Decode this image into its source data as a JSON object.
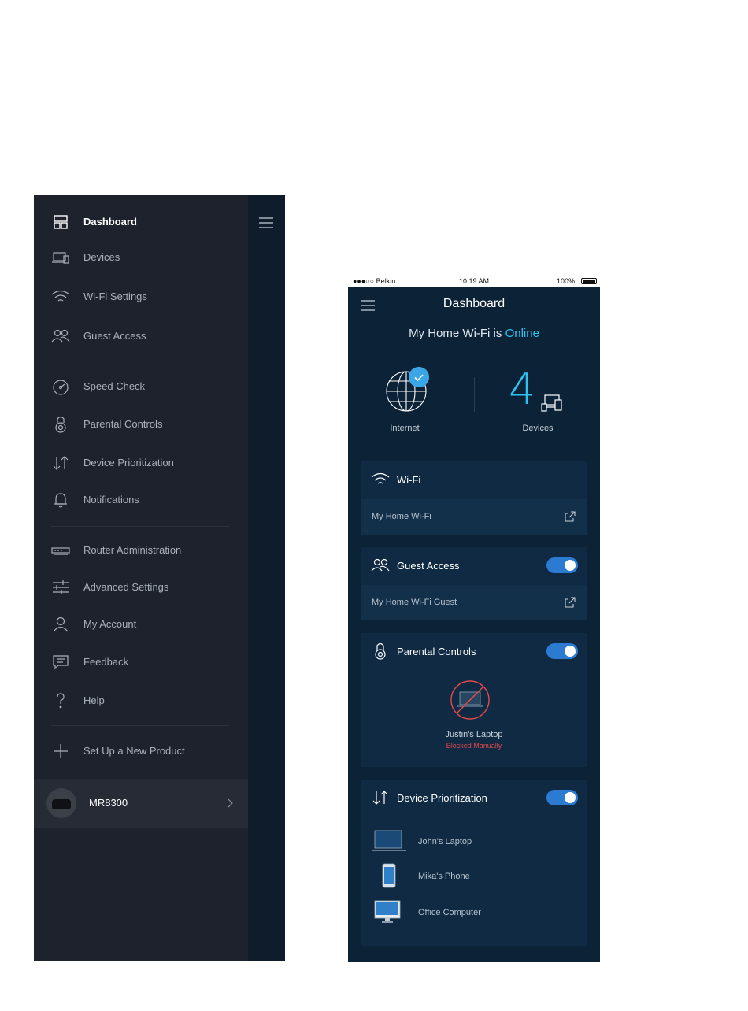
{
  "menu": {
    "items": [
      {
        "label": "Dashboard",
        "icon": "dashboard-icon",
        "active": true
      },
      {
        "label": "Devices",
        "icon": "devices-icon"
      },
      {
        "label": "Wi-Fi Settings",
        "icon": "wifi-icon"
      },
      {
        "label": "Guest Access",
        "icon": "guests-icon"
      },
      {
        "label": "Speed Check",
        "icon": "speedometer-icon"
      },
      {
        "label": "Parental Controls",
        "icon": "lock-icon"
      },
      {
        "label": "Device Prioritization",
        "icon": "up-down-arrows-icon"
      },
      {
        "label": "Notifications",
        "icon": "bell-icon"
      },
      {
        "label": "Router Administration",
        "icon": "router-icon"
      },
      {
        "label": "Advanced Settings",
        "icon": "sliders-icon"
      },
      {
        "label": "My Account",
        "icon": "person-icon"
      },
      {
        "label": "Feedback",
        "icon": "chat-icon"
      },
      {
        "label": "Help",
        "icon": "question-icon"
      },
      {
        "label": "Set Up a New Product",
        "icon": "plus-icon"
      }
    ],
    "account": {
      "label": "MR8300"
    }
  },
  "status_bar": {
    "carrier": "●●●○○ Belkin",
    "time": "10:19 AM",
    "battery": "100%"
  },
  "dashboard": {
    "title": "Dashboard",
    "status_prefix": "My Home Wi-Fi is ",
    "status_value": "Online",
    "internet_label": "Internet",
    "devices_count": "4",
    "devices_label": "Devices",
    "wifi_card": {
      "title": "Wi-Fi",
      "network": "My Home Wi-Fi"
    },
    "guest_card": {
      "title": "Guest Access",
      "network": "My Home Wi-Fi Guest",
      "enabled": true
    },
    "parental_card": {
      "title": "Parental Controls",
      "device": "Justin's Laptop",
      "device_status": "Blocked Manually",
      "enabled": true
    },
    "prioritization_card": {
      "title": "Device Prioritization",
      "enabled": true,
      "devices": [
        {
          "label": "John's Laptop",
          "icon": "laptop-icon"
        },
        {
          "label": "Mika's Phone",
          "icon": "phone-icon"
        },
        {
          "label": "Office Computer",
          "icon": "monitor-icon"
        }
      ]
    }
  },
  "colors": {
    "accent": "#2fc4f2",
    "toggle_on": "#2b7bd2",
    "blocked": "#e5484d",
    "menu_bg": "#1e222c",
    "dashboard_bg": "#0c2236"
  }
}
